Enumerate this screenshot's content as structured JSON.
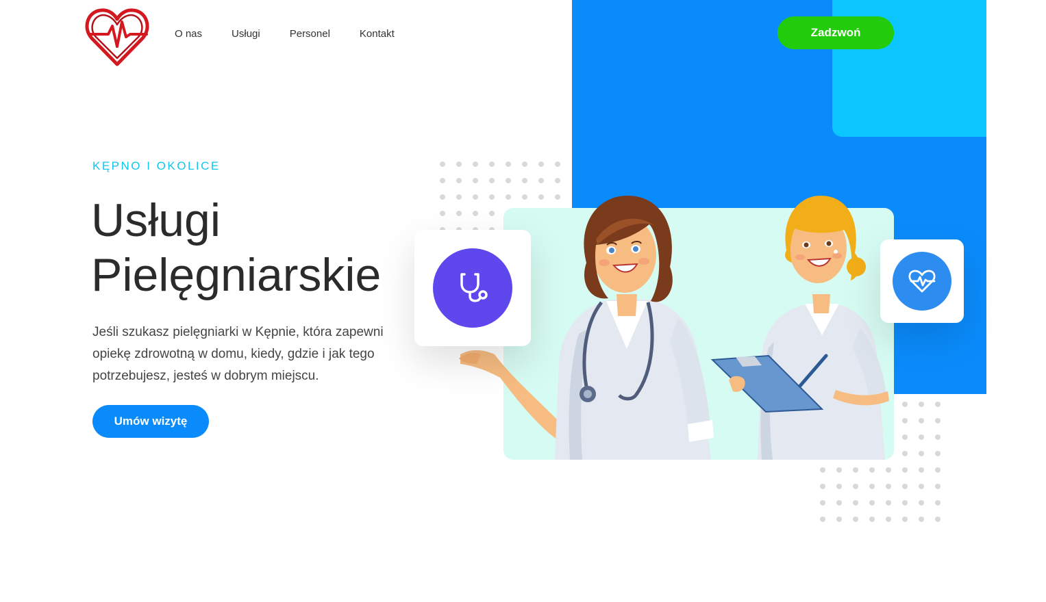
{
  "header": {
    "logo": "heart-pulse-logo",
    "nav": [
      {
        "label": "O nas"
      },
      {
        "label": "Usługi"
      },
      {
        "label": "Personel"
      },
      {
        "label": "Kontakt"
      }
    ],
    "call_button": "Zadzwoń"
  },
  "hero": {
    "eyebrow": "KĘPNO I OKOLICE",
    "title_line1": "Usługi",
    "title_line2": "Pielęgniarskie",
    "description": "Jeśli szukasz pielęgniarki w Kępnie, która zapewni opiekę zdrowotną w domu, kiedy, gdzie i jak tego potrzebujesz, jesteś w dobrym miejscu.",
    "cta_button": "Umów wizytę"
  },
  "illustration": {
    "icons": [
      "stethoscope-icon",
      "heart-pulse-icon"
    ]
  },
  "colors": {
    "brand_blue": "#0a8bfb",
    "accent_cyan": "#0cc6ff",
    "call_green": "#22cc0a",
    "logo_red": "#d41820",
    "icon_purple": "#5f47ee"
  }
}
